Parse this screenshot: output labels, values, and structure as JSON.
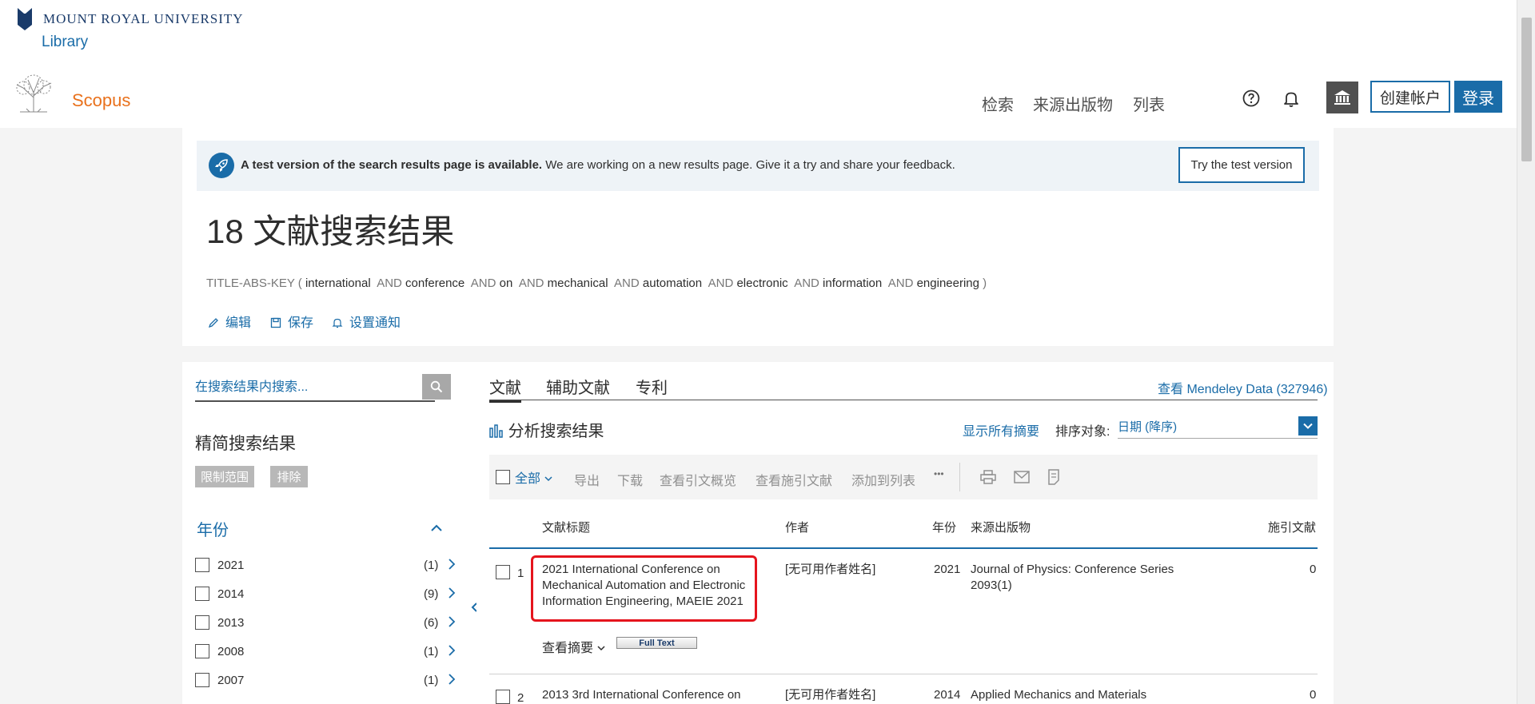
{
  "header": {
    "university": "MOUNT ROYAL UNIVERSITY",
    "library": "Library",
    "brand": "Scopus",
    "nav": [
      "检索",
      "来源出版物",
      "列表"
    ],
    "create_account": "创建帐户",
    "login": "登录"
  },
  "banner": {
    "bold": "A test version of the search results page is available.",
    "text": " We are working on a new results page. Give it a try and share your feedback.",
    "button": "Try the test version"
  },
  "results": {
    "title": "18 文献搜索结果",
    "query_prefix": "TITLE-ABS-KEY (",
    "query_terms": [
      "international",
      "conference",
      "on",
      "mechanical",
      "automation",
      "electronic",
      "information",
      "engineering"
    ],
    "query_op": "AND",
    "query_suffix": ")",
    "actions": [
      "编辑",
      "保存",
      "设置通知"
    ]
  },
  "sidebar": {
    "search_placeholder": "在搜索结果内搜索...",
    "refine_title": "精简搜索结果",
    "limit": "限制范围",
    "exclude": "排除",
    "facet_title": "年份",
    "years": [
      {
        "label": "2021",
        "count": "(1)"
      },
      {
        "label": "2014",
        "count": "(9)"
      },
      {
        "label": "2013",
        "count": "(6)"
      },
      {
        "label": "2008",
        "count": "(1)"
      },
      {
        "label": "2007",
        "count": "(1)"
      }
    ]
  },
  "main": {
    "tabs": [
      "文献",
      "辅助文献",
      "专利"
    ],
    "mendeley": "查看 Mendeley Data (327946)",
    "analyze": "分析搜索结果",
    "show_all_abstracts": "显示所有摘要",
    "sort_label": "排序对象:",
    "sort_value": "日期 (降序)",
    "toolbar": {
      "all": "全部",
      "export": "导出",
      "download": "下载",
      "citation_overview": "查看引文概览",
      "cited_by": "查看施引文献",
      "add_to_list": "添加到列表",
      "more": "•••"
    },
    "columns": {
      "title": "文献标题",
      "authors": "作者",
      "year": "年份",
      "source": "来源出版物",
      "cited": "施引文献"
    },
    "rows": [
      {
        "num": "1",
        "title_lines": [
          "2021 International Conference on",
          "Mechanical Automation and Electronic",
          "Information Engineering, MAEIE 2021"
        ],
        "authors": "[无可用作者姓名]",
        "year": "2021",
        "source_lines": [
          "Journal of Physics: Conference Series",
          "2093(1)"
        ],
        "cited": "0",
        "view_abstract": "查看摘要",
        "full_text": "Full Text"
      },
      {
        "num": "2",
        "title_lines": [
          "2013 3rd International Conference on"
        ],
        "authors": "[无可用作者姓名]",
        "year": "2014",
        "source_lines": [
          "Applied Mechanics and Materials"
        ],
        "cited": "0"
      }
    ]
  },
  "colors": {
    "accent": "#1a6ca8",
    "scopus_orange": "#e9711c",
    "highlight": "#e5141d"
  }
}
